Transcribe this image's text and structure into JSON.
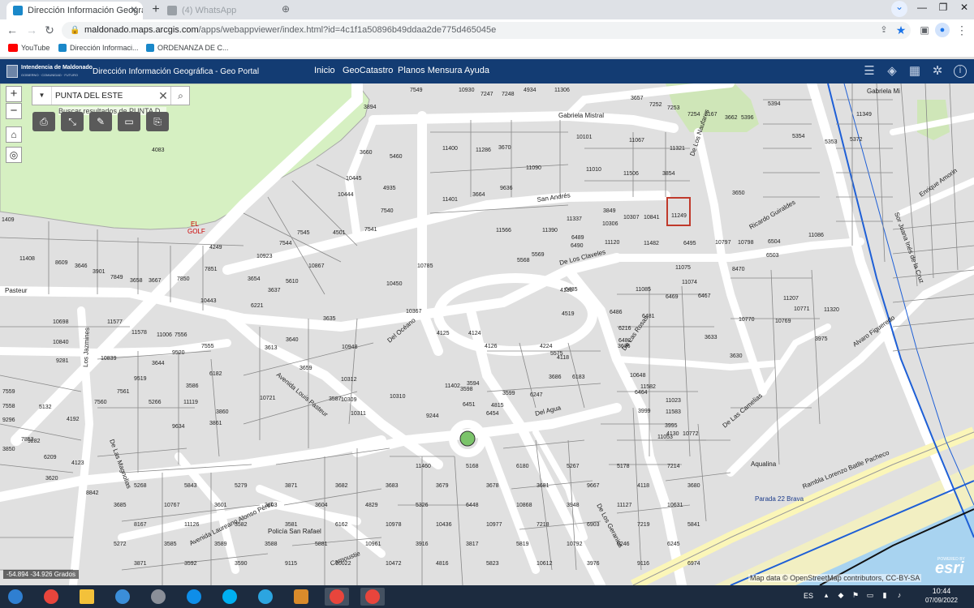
{
  "browser": {
    "tabs": [
      {
        "title": "Dirección Información Geográfica",
        "active": true
      },
      {
        "title": "(4) WhatsApp",
        "active": false
      }
    ],
    "new_tab_icon": "plus-icon",
    "url_host": "maldonado.maps.arcgis.com",
    "url_path": "/apps/webappviewer/index.html?id=4c1f1a50896b49ddaa2de775d465045e",
    "bookmarks": [
      {
        "label": "YouTube",
        "color": "#ff0000"
      },
      {
        "label": "Dirección Informaci...",
        "color": "#1a88c9"
      },
      {
        "label": "ORDENANZA DE C...",
        "color": "#1a88c9"
      }
    ]
  },
  "app": {
    "logo_text": "Intendencia de Maldonado",
    "logo_subtext": "GOBIERNO · COMUNIDAD · FUTURO",
    "title": "Dirección Información Geográfica - Geo Portal",
    "nav": [
      "Inicio",
      "GeoCatastro",
      "Planos Mensura",
      "Ayuda"
    ],
    "header_color": "#133c73",
    "header_icons": [
      "list-icon",
      "layers-icon",
      "grid-icon",
      "share-icon",
      "info-icon"
    ]
  },
  "map": {
    "search_value": "PUNTA DEL ESTE",
    "search_hint": "Buscar resultados de PUNTA D...",
    "zoom_in": "+",
    "zoom_out": "−",
    "tools": [
      "print-icon",
      "measure-icon",
      "draw-icon",
      "select-icon",
      "bookmark-icon"
    ],
    "coordinates": "-54.894 -34.926 Grados",
    "attribution": "Map data © OpenStreetMap contributors, CC-BY-SA",
    "esri_small": "POWERED BY",
    "esri_logo": "esri",
    "golf_label_1": "EL",
    "golf_label_2": "GOLF",
    "streets": [
      "Gabriela Mistral",
      "San Andrés",
      "De Los Claveles",
      "De Los Naufares",
      "Ricardo Guiraldes",
      "Pasteur",
      "Los Jazmines",
      "Del Océano",
      "Avenida Louis Pasteur",
      "De Las Magnolias",
      "Del Agua",
      "De Las Rosas",
      "De Las Camelias",
      "Avenida Laureano Alonso Pérez",
      "Rambla Lorenzo Batlle Pacheco",
      "Aqualina",
      "Enrique Amorin",
      "Alvaro Figueredo",
      "Sor Juana Inés de la Cruz",
      "Carnoustie",
      "De Los Geranios",
      "Gabriela Mi"
    ],
    "poi": [
      "Policía San Rafael",
      "Parada 22 Brava"
    ],
    "parcels_top": [
      "7549",
      "10930",
      "7247",
      "7248",
      "4934",
      "11306",
      "3657",
      "7252",
      "7253",
      "7254",
      "7167",
      "3662",
      "5396",
      "5394",
      "3894",
      "11349",
      "10101",
      "11067",
      "11321",
      "5354",
      "5372",
      "5353"
    ],
    "parcels_mid": [
      "3660",
      "5460",
      "11400",
      "11286",
      "3670",
      "11090",
      "11010",
      "11506",
      "3854",
      "3650",
      "10445",
      "4935",
      "10444",
      "9636",
      "3664",
      "11401",
      "7540",
      "7541",
      "4501",
      "7545",
      "7544",
      "4083",
      "1409",
      "4249",
      "7851",
      "11408",
      "8609",
      "3646",
      "3901",
      "7849",
      "3658",
      "3667",
      "7850",
      "10923",
      "10867",
      "3654",
      "5610",
      "3637",
      "6221",
      "10443",
      "3849",
      "10307",
      "10841",
      "11249",
      "10306",
      "11120",
      "11482",
      "6495",
      "11337",
      "11390",
      "6489",
      "6490",
      "11566",
      "5569",
      "5568",
      "10785",
      "10450",
      "10367",
      "10797",
      "10798",
      "6504",
      "6503",
      "11086",
      "8470",
      "6485",
      "4130",
      "4519",
      "6486",
      "6481",
      "11085",
      "6216",
      "6482",
      "11075",
      "11074",
      "6469",
      "6467",
      "10770",
      "11207",
      "10771",
      "11320",
      "10769",
      "3975",
      "3633",
      "3630",
      "3636",
      "3635",
      "10948",
      "3640",
      "3613",
      "3659",
      "11577",
      "11578",
      "11006",
      "7556",
      "7555",
      "10698",
      "10840",
      "9281",
      "10839",
      "3644",
      "9520",
      "9519",
      "6182",
      "3586",
      "11119",
      "10721",
      "5266",
      "9634",
      "3860",
      "3861",
      "4192",
      "3850",
      "7852",
      "7560",
      "7561",
      "7559",
      "7558",
      "9296",
      "5132",
      "9282",
      "6209",
      "3620",
      "4123",
      "8842",
      "4815",
      "4125",
      "4124",
      "4126",
      "4224",
      "4118",
      "3686",
      "5575",
      "6183",
      "3594",
      "11402",
      "3598",
      "6451",
      "3599",
      "6247",
      "6454",
      "10648",
      "6464",
      "11582",
      "3999",
      "11023",
      "11583",
      "3995",
      "4130",
      "10772",
      "11053"
    ],
    "parcels_bottom": [
      "10312",
      "10309",
      "10311",
      "10310",
      "3587",
      "9244",
      "11460",
      "5168",
      "6180",
      "5267",
      "5178",
      "7214",
      "5268",
      "5843",
      "5279",
      "3871",
      "3682",
      "3683",
      "3679",
      "3678",
      "3681",
      "9667",
      "4118",
      "3680",
      "3685",
      "10767",
      "3601",
      "3603",
      "3604",
      "4829",
      "5326",
      "6448",
      "10868",
      "3948",
      "11127",
      "10631",
      "8167",
      "11126",
      "3582",
      "3581",
      "6162",
      "10978",
      "10436",
      "10977",
      "7218",
      "6903",
      "7219",
      "5841",
      "5272",
      "3585",
      "3589",
      "3588",
      "5881",
      "10961",
      "3916",
      "3817",
      "5819",
      "10792",
      "6246",
      "6245",
      "3871",
      "3592",
      "3590",
      "9115",
      "10022",
      "10472",
      "4816",
      "5823",
      "10612",
      "3976",
      "9116",
      "6974"
    ]
  },
  "taskbar": {
    "apps": [
      "start-icon",
      "chrome-icon",
      "explorer-icon",
      "ie-icon",
      "tool-icon",
      "teamviewer-icon",
      "skype-icon",
      "telegram-icon",
      "media-icon",
      "chrome-window-icon",
      "chrome-window-icon"
    ],
    "lang": "ES",
    "time": "10:44",
    "date": "07/09/2022"
  }
}
